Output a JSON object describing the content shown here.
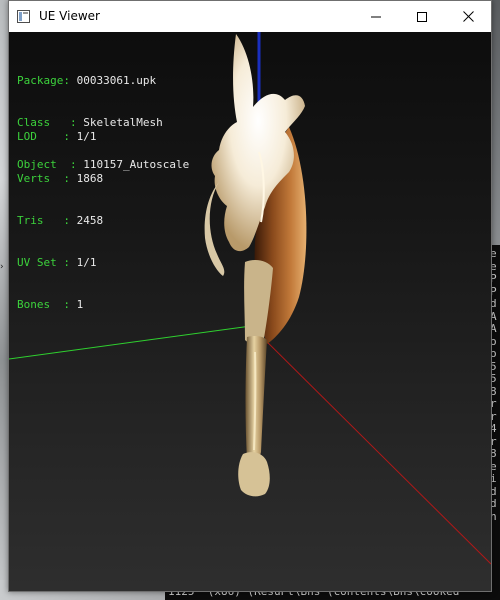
{
  "window": {
    "title": "UE Viewer",
    "icon": "app-window-icon",
    "controls": {
      "minimize_icon": "minimize-icon",
      "maximize_icon": "maximize-icon",
      "close_icon": "close-icon"
    }
  },
  "mesh_info": {
    "package": {
      "label": "Package",
      "value": "00033061.upk"
    },
    "class": {
      "label": "Class",
      "value": "SkeletalMesh"
    },
    "object": {
      "label": "Object",
      "value": "110157_Autoscale"
    }
  },
  "mesh_stats": {
    "lod": {
      "label": "LOD",
      "value": "1/1"
    },
    "verts": {
      "label": "Verts",
      "value": "1868"
    },
    "tris": {
      "label": "Tris",
      "value": "2458"
    },
    "uv_set": {
      "label": "UV Set",
      "value": "1/1"
    },
    "bones": {
      "label": "Bones",
      "value": "1"
    }
  },
  "viewport_model": "axe-skeletal-mesh",
  "axes": {
    "x_color": "#b01818",
    "y_color": "#2fd02f",
    "z_color": "#1a2fbf"
  },
  "colors": {
    "label_color": "#3cd23c",
    "value_color": "#e8e8e8",
    "viewport_top": "#0d0d0d",
    "viewport_bottom": "#2e2e2e"
  },
  "background_console": {
    "side_chars": [
      "e",
      "e",
      "P",
      "P",
      "d",
      "A",
      "A",
      "o",
      "o",
      "5",
      "5",
      "8",
      "r",
      "r",
      "4",
      "r",
      "8",
      "e",
      "i",
      "d",
      "d",
      "n"
    ],
    "bottom_line": "1125' (x86) (ResuPl\\Bns (contents\\Bns\\cooked"
  }
}
